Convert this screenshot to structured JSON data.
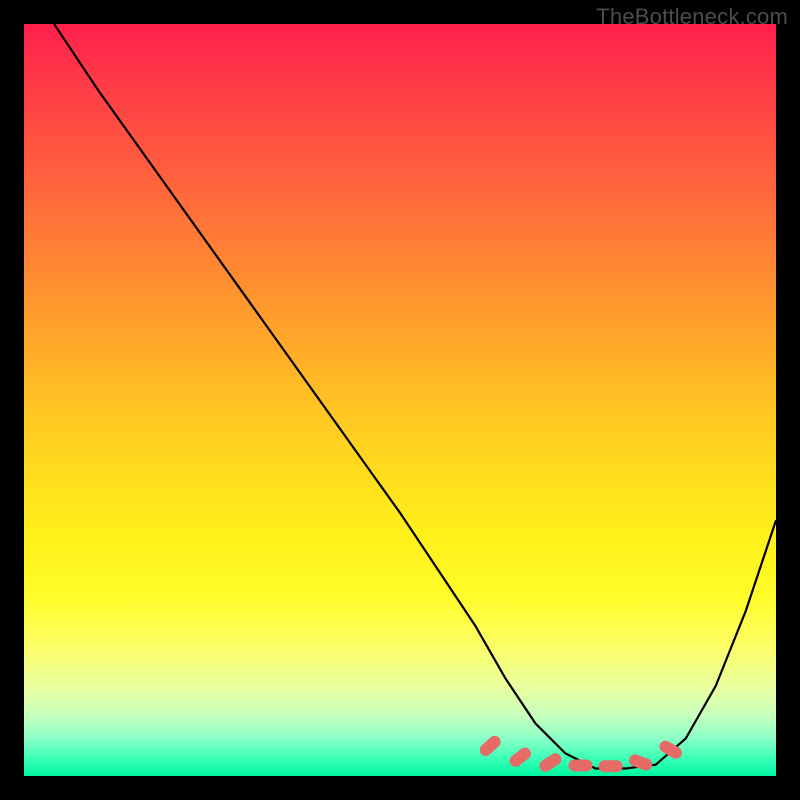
{
  "watermark": "TheBottleneck.com",
  "chart_data": {
    "type": "line",
    "title": "",
    "xlabel": "",
    "ylabel": "",
    "xlim": [
      0,
      100
    ],
    "ylim": [
      0,
      100
    ],
    "series": [
      {
        "name": "bottleneck-curve",
        "x": [
          4,
          10,
          20,
          30,
          40,
          50,
          60,
          64,
          68,
          72,
          76,
          80,
          84,
          88,
          92,
          96,
          100
        ],
        "y": [
          100,
          91,
          77,
          63,
          49,
          35,
          20,
          13,
          7,
          3,
          1,
          1,
          1.5,
          5,
          12,
          22,
          34
        ]
      }
    ],
    "highlight_zone": {
      "name": "optimal-range-markers",
      "x": [
        62,
        66,
        70,
        74,
        78,
        82,
        86
      ],
      "y": [
        4,
        2.5,
        1.8,
        1.4,
        1.3,
        1.8,
        3.5
      ],
      "color": "#e66a66"
    },
    "gradient_stops": [
      {
        "pos": 0,
        "color": "#ff1f4b"
      },
      {
        "pos": 50,
        "color": "#ffd81e"
      },
      {
        "pos": 85,
        "color": "#fcff6a"
      },
      {
        "pos": 100,
        "color": "#00f59f"
      }
    ]
  }
}
